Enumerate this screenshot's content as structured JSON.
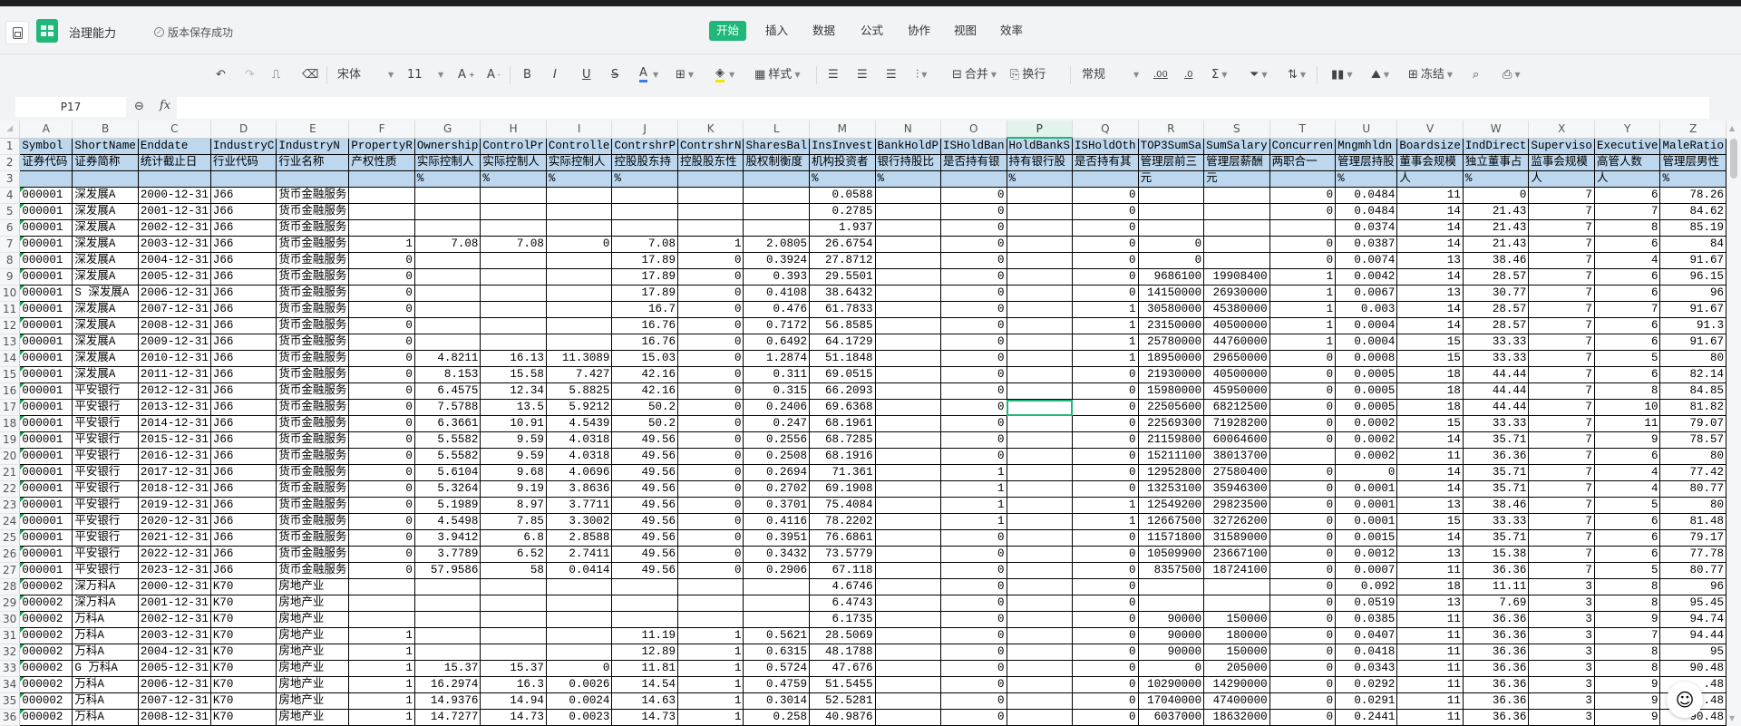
{
  "app": {
    "doc_title": "治理能力",
    "save_status": "版本保存成功",
    "accent": "#1fb87a"
  },
  "menu_tabs": [
    "开始",
    "插入",
    "数据",
    "公式",
    "协作",
    "视图",
    "效率"
  ],
  "toolbar": {
    "font_name": "宋体",
    "font_size": "11",
    "style_label": "样式",
    "merge_label": "合并",
    "wrap_label": "换行",
    "number_format": "常规",
    "freeze_label": "冻结",
    "bold": "B",
    "italic": "I",
    "underline": "U",
    "strike": "S",
    "font_color": "A",
    "inc_decimal": ".00",
    "dec_decimal": ".0",
    "sum": "Σ"
  },
  "formula_bar": {
    "cell_ref": "P17",
    "fx": "fx",
    "value": ""
  },
  "grid": {
    "columns": [
      "A",
      "B",
      "C",
      "D",
      "E",
      "F",
      "G",
      "H",
      "I",
      "J",
      "K",
      "L",
      "M",
      "N",
      "O",
      "P",
      "Q",
      "R",
      "S",
      "T",
      "U",
      "V",
      "W",
      "X",
      "Y",
      "Z"
    ],
    "selected_column": "P",
    "selected_cell": {
      "row": 17,
      "col": "P"
    },
    "header_rows": [
      [
        "Symbol",
        "ShortName",
        "Enddate",
        "IndustryC",
        "IndustryN",
        "PropertyR",
        "Ownership",
        "ControlPr",
        "Controlle",
        "ContrshrP",
        "ContrshrN",
        "SharesBal",
        "InsInvest",
        "BankHoldP",
        "ISHoldBan",
        "HoldBankS",
        "ISHoldOth",
        "TOP3SumSa",
        "SumSalary",
        "Concurren",
        "Mngmhldn",
        "Boardsize",
        "IndDirect",
        "Superviso",
        "Executive",
        "MaleRatio"
      ],
      [
        "证券代码",
        "证券简称",
        "统计截止日",
        "行业代码",
        "行业名称",
        "产权性质",
        "实际控制人",
        "实际控制人",
        "实际控制人",
        "控股股东持",
        "控股股东性",
        "股权制衡度",
        "机构投资者",
        "银行持股比",
        "是否持有银",
        "持有银行股",
        "是否持有其",
        "管理层前三",
        "管理层薪酬",
        "两职合一",
        "管理层持股",
        "董事会规模",
        "独立董事占",
        "监事会规模",
        "高管人数",
        "管理层男性"
      ],
      [
        "",
        "",
        "",
        "",
        "",
        "",
        "%",
        "%",
        "%",
        "%",
        "",
        "",
        "%",
        "%",
        "",
        "%",
        "",
        "元",
        "元",
        "",
        "%",
        "人",
        "%",
        "人",
        "人",
        "%"
      ]
    ],
    "rows": [
      [
        "000001",
        "深发展A",
        "2000-12-31",
        "J66",
        "货币金融服务",
        "",
        "",
        "",
        "",
        "",
        "",
        "",
        "0.0588",
        "",
        "0",
        "",
        "0",
        "",
        "",
        "0",
        "0.0484",
        "11",
        "0",
        "7",
        "6",
        "78.26"
      ],
      [
        "000001",
        "深发展A",
        "2001-12-31",
        "J66",
        "货币金融服务",
        "",
        "",
        "",
        "",
        "",
        "",
        "",
        "0.2785",
        "",
        "0",
        "",
        "0",
        "",
        "",
        "0",
        "0.0484",
        "14",
        "21.43",
        "7",
        "7",
        "84.62"
      ],
      [
        "000001",
        "深发展A",
        "2002-12-31",
        "J66",
        "货币金融服务",
        "",
        "",
        "",
        "",
        "",
        "",
        "",
        "1.937",
        "",
        "0",
        "",
        "0",
        "",
        "",
        "",
        "0.0374",
        "14",
        "21.43",
        "7",
        "8",
        "85.19"
      ],
      [
        "000001",
        "深发展A",
        "2003-12-31",
        "J66",
        "货币金融服务",
        "1",
        "7.08",
        "7.08",
        "0",
        "7.08",
        "1",
        "2.0805",
        "26.6754",
        "",
        "0",
        "",
        "0",
        "0",
        "",
        "0",
        "0.0387",
        "14",
        "21.43",
        "7",
        "6",
        "84"
      ],
      [
        "000001",
        "深发展A",
        "2004-12-31",
        "J66",
        "货币金融服务",
        "0",
        "",
        "",
        "",
        "17.89",
        "0",
        "0.3924",
        "27.8712",
        "",
        "0",
        "",
        "0",
        "0",
        "",
        "0",
        "0.0074",
        "13",
        "38.46",
        "7",
        "4",
        "91.67"
      ],
      [
        "000001",
        "深发展A",
        "2005-12-31",
        "J66",
        "货币金融服务",
        "0",
        "",
        "",
        "",
        "17.89",
        "0",
        "0.393",
        "29.5501",
        "",
        "0",
        "",
        "0",
        "9686100",
        "19908400",
        "1",
        "0.0042",
        "14",
        "28.57",
        "7",
        "6",
        "96.15"
      ],
      [
        "000001",
        "S 深发展A",
        "2006-12-31",
        "J66",
        "货币金融服务",
        "0",
        "",
        "",
        "",
        "17.89",
        "0",
        "0.4108",
        "38.6432",
        "",
        "0",
        "",
        "0",
        "14150000",
        "26930000",
        "1",
        "0.0067",
        "13",
        "30.77",
        "7",
        "6",
        "96"
      ],
      [
        "000001",
        "深发展A",
        "2007-12-31",
        "J66",
        "货币金融服务",
        "0",
        "",
        "",
        "",
        "16.7",
        "0",
        "0.476",
        "61.7833",
        "",
        "0",
        "",
        "1",
        "30580000",
        "45380000",
        "1",
        "0.003",
        "14",
        "28.57",
        "7",
        "7",
        "91.67"
      ],
      [
        "000001",
        "深发展A",
        "2008-12-31",
        "J66",
        "货币金融服务",
        "0",
        "",
        "",
        "",
        "16.76",
        "0",
        "0.7172",
        "56.8585",
        "",
        "0",
        "",
        "1",
        "23150000",
        "40500000",
        "1",
        "0.0004",
        "14",
        "28.57",
        "7",
        "6",
        "91.3"
      ],
      [
        "000001",
        "深发展A",
        "2009-12-31",
        "J66",
        "货币金融服务",
        "0",
        "",
        "",
        "",
        "16.76",
        "0",
        "0.6492",
        "64.1729",
        "",
        "0",
        "",
        "1",
        "25780000",
        "44760000",
        "1",
        "0.0004",
        "15",
        "33.33",
        "7",
        "6",
        "91.67"
      ],
      [
        "000001",
        "深发展A",
        "2010-12-31",
        "J66",
        "货币金融服务",
        "0",
        "4.8211",
        "16.13",
        "11.3089",
        "15.03",
        "0",
        "1.2874",
        "51.1848",
        "",
        "0",
        "",
        "1",
        "18950000",
        "29650000",
        "0",
        "0.0008",
        "15",
        "33.33",
        "7",
        "5",
        "80"
      ],
      [
        "000001",
        "深发展A",
        "2011-12-31",
        "J66",
        "货币金融服务",
        "0",
        "8.153",
        "15.58",
        "7.427",
        "42.16",
        "0",
        "0.311",
        "69.0515",
        "",
        "0",
        "",
        "0",
        "21930000",
        "40500000",
        "0",
        "0.0005",
        "18",
        "44.44",
        "7",
        "6",
        "82.14"
      ],
      [
        "000001",
        "平安银行",
        "2012-12-31",
        "J66",
        "货币金融服务",
        "0",
        "6.4575",
        "12.34",
        "5.8825",
        "42.16",
        "0",
        "0.315",
        "66.2093",
        "",
        "0",
        "",
        "0",
        "15980000",
        "45950000",
        "0",
        "0.0005",
        "18",
        "44.44",
        "7",
        "8",
        "84.85"
      ],
      [
        "000001",
        "平安银行",
        "2013-12-31",
        "J66",
        "货币金融服务",
        "0",
        "7.5788",
        "13.5",
        "5.9212",
        "50.2",
        "0",
        "0.2406",
        "69.6368",
        "",
        "0",
        "",
        "0",
        "22505600",
        "68212500",
        "0",
        "0.0005",
        "18",
        "44.44",
        "7",
        "10",
        "81.82"
      ],
      [
        "000001",
        "平安银行",
        "2014-12-31",
        "J66",
        "货币金融服务",
        "0",
        "6.3661",
        "10.91",
        "4.5439",
        "50.2",
        "0",
        "0.247",
        "68.1961",
        "",
        "0",
        "",
        "0",
        "22569300",
        "71928200",
        "0",
        "0.0002",
        "15",
        "33.33",
        "7",
        "11",
        "79.07"
      ],
      [
        "000001",
        "平安银行",
        "2015-12-31",
        "J66",
        "货币金融服务",
        "0",
        "5.5582",
        "9.59",
        "4.0318",
        "49.56",
        "0",
        "0.2556",
        "68.7285",
        "",
        "0",
        "",
        "0",
        "21159800",
        "60064600",
        "0",
        "0.0002",
        "14",
        "35.71",
        "7",
        "9",
        "78.57"
      ],
      [
        "000001",
        "平安银行",
        "2016-12-31",
        "J66",
        "货币金融服务",
        "0",
        "5.5582",
        "9.59",
        "4.0318",
        "49.56",
        "0",
        "0.2508",
        "68.1916",
        "",
        "0",
        "",
        "0",
        "15211100",
        "38013700",
        "",
        "0.0002",
        "11",
        "36.36",
        "7",
        "6",
        "80"
      ],
      [
        "000001",
        "平安银行",
        "2017-12-31",
        "J66",
        "货币金融服务",
        "0",
        "5.6104",
        "9.68",
        "4.0696",
        "49.56",
        "0",
        "0.2694",
        "71.361",
        "",
        "1",
        "",
        "0",
        "12952800",
        "27580400",
        "0",
        "0",
        "14",
        "35.71",
        "7",
        "4",
        "77.42"
      ],
      [
        "000001",
        "平安银行",
        "2018-12-31",
        "J66",
        "货币金融服务",
        "0",
        "5.3264",
        "9.19",
        "3.8636",
        "49.56",
        "0",
        "0.2702",
        "69.1908",
        "",
        "1",
        "",
        "0",
        "13253100",
        "35946300",
        "0",
        "0.0001",
        "14",
        "35.71",
        "7",
        "4",
        "80.77"
      ],
      [
        "000001",
        "平安银行",
        "2019-12-31",
        "J66",
        "货币金融服务",
        "0",
        "5.1989",
        "8.97",
        "3.7711",
        "49.56",
        "0",
        "0.3701",
        "75.4084",
        "",
        "1",
        "",
        "1",
        "12549200",
        "29823500",
        "0",
        "0.0001",
        "13",
        "38.46",
        "7",
        "5",
        "80"
      ],
      [
        "000001",
        "平安银行",
        "2020-12-31",
        "J66",
        "货币金融服务",
        "0",
        "4.5498",
        "7.85",
        "3.3002",
        "49.56",
        "0",
        "0.4116",
        "78.2202",
        "",
        "1",
        "",
        "1",
        "12667500",
        "32726200",
        "0",
        "0.0001",
        "15",
        "33.33",
        "7",
        "6",
        "81.48"
      ],
      [
        "000001",
        "平安银行",
        "2021-12-31",
        "J66",
        "货币金融服务",
        "0",
        "3.9412",
        "6.8",
        "2.8588",
        "49.56",
        "0",
        "0.3951",
        "76.6861",
        "",
        "0",
        "",
        "0",
        "11571800",
        "31589000",
        "0",
        "0.0015",
        "14",
        "35.71",
        "7",
        "6",
        "79.17"
      ],
      [
        "000001",
        "平安银行",
        "2022-12-31",
        "J66",
        "货币金融服务",
        "0",
        "3.7789",
        "6.52",
        "2.7411",
        "49.56",
        "0",
        "0.3432",
        "73.5779",
        "",
        "0",
        "",
        "0",
        "10509900",
        "23667100",
        "0",
        "0.0012",
        "13",
        "15.38",
        "7",
        "6",
        "77.78"
      ],
      [
        "000001",
        "平安银行",
        "2023-12-31",
        "J66",
        "货币金融服务",
        "0",
        "57.9586",
        "58",
        "0.0414",
        "49.56",
        "0",
        "0.2906",
        "67.118",
        "",
        "0",
        "",
        "0",
        "8357500",
        "18724100",
        "0",
        "0.0007",
        "11",
        "36.36",
        "7",
        "5",
        "80.77"
      ],
      [
        "000002",
        "深万科A",
        "2000-12-31",
        "K70",
        "房地产业",
        "",
        "",
        "",
        "",
        "",
        "",
        "",
        "4.6746",
        "",
        "0",
        "",
        "0",
        "",
        "",
        "0",
        "0.092",
        "18",
        "11.11",
        "3",
        "8",
        "96"
      ],
      [
        "000002",
        "深万科A",
        "2001-12-31",
        "K70",
        "房地产业",
        "",
        "",
        "",
        "",
        "",
        "",
        "",
        "6.4743",
        "",
        "0",
        "",
        "0",
        "",
        "",
        "0",
        "0.0519",
        "13",
        "7.69",
        "3",
        "8",
        "95.45"
      ],
      [
        "000002",
        "万科A",
        "2002-12-31",
        "K70",
        "房地产业",
        "",
        "",
        "",
        "",
        "",
        "",
        "",
        "6.1735",
        "",
        "0",
        "",
        "0",
        "90000",
        "150000",
        "0",
        "0.0385",
        "11",
        "36.36",
        "3",
        "9",
        "94.74"
      ],
      [
        "000002",
        "万科A",
        "2003-12-31",
        "K70",
        "房地产业",
        "1",
        "",
        "",
        "",
        "11.19",
        "1",
        "0.5621",
        "28.5069",
        "",
        "0",
        "",
        "0",
        "90000",
        "180000",
        "0",
        "0.0407",
        "11",
        "36.36",
        "3",
        "7",
        "94.44"
      ],
      [
        "000002",
        "万科A",
        "2004-12-31",
        "K70",
        "房地产业",
        "1",
        "",
        "",
        "",
        "12.89",
        "1",
        "0.6315",
        "48.1788",
        "",
        "0",
        "",
        "0",
        "90000",
        "150000",
        "0",
        "0.0418",
        "11",
        "36.36",
        "3",
        "8",
        "95"
      ],
      [
        "000002",
        "G 万科A",
        "2005-12-31",
        "K70",
        "房地产业",
        "1",
        "15.37",
        "15.37",
        "0",
        "11.81",
        "1",
        "0.5724",
        "47.676",
        "",
        "0",
        "",
        "0",
        "0",
        "205000",
        "0",
        "0.0343",
        "11",
        "36.36",
        "3",
        "8",
        "90.48"
      ],
      [
        "000002",
        "万科A",
        "2006-12-31",
        "K70",
        "房地产业",
        "1",
        "16.2974",
        "16.3",
        "0.0026",
        "14.54",
        "1",
        "0.4759",
        "51.5455",
        "",
        "0",
        "",
        "0",
        "10290000",
        "14290000",
        "0",
        "0.0292",
        "11",
        "36.36",
        "3",
        "9",
        ".48"
      ],
      [
        "000002",
        "万科A",
        "2007-12-31",
        "K70",
        "房地产业",
        "1",
        "14.9376",
        "14.94",
        "0.0024",
        "14.63",
        "1",
        "0.3014",
        "52.5281",
        "",
        "0",
        "",
        "0",
        "17040000",
        "47400000",
        "0",
        "0.0291",
        "11",
        "36.36",
        "3",
        "9",
        ".48"
      ],
      [
        "000002",
        "万科A",
        "2008-12-31",
        "K70",
        "房地产业",
        "1",
        "14.7277",
        "14.73",
        "0.0023",
        "14.73",
        "1",
        "0.258",
        "40.9876",
        "",
        "0",
        "",
        "0",
        "6037000",
        "18632000",
        "0",
        "0.2441",
        "11",
        "36.36",
        "3",
        "9",
        "90.48"
      ]
    ]
  }
}
